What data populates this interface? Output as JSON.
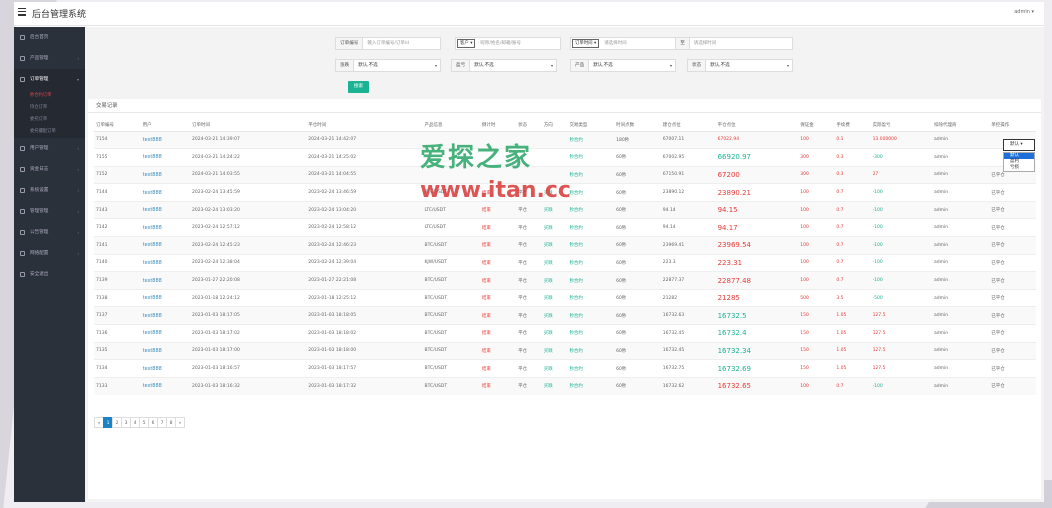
{
  "app": {
    "title": "后台管理系统",
    "user": "admin ▾"
  },
  "sidebar": [
    {
      "label": "后台首页",
      "active": false,
      "arrow": ""
    },
    {
      "label": "产品管理",
      "active": false,
      "arrow": "‹"
    },
    {
      "label": "订单管理",
      "active": true,
      "arrow": "▾"
    },
    {
      "label": "用户管理",
      "active": false,
      "arrow": "‹"
    },
    {
      "label": "资金日志",
      "active": false,
      "arrow": "‹"
    },
    {
      "label": "系统设置",
      "active": false,
      "arrow": "‹"
    },
    {
      "label": "管理管理",
      "active": false,
      "arrow": "‹"
    },
    {
      "label": "公告管理",
      "active": false,
      "arrow": "‹"
    },
    {
      "label": "网络配置",
      "active": false,
      "arrow": "‹"
    },
    {
      "label": "安全退出",
      "active": false,
      "arrow": ""
    }
  ],
  "sidebar_sub": [
    "秒合约订单",
    "持仓订单",
    "委托订单",
    "委托撮配订单"
  ],
  "filters": {
    "order_no_label": "订单编号",
    "order_no_placeholder": "输入订单编号/订单id",
    "user_select": "客户",
    "user_placeholder": "昵称/姓名/邮箱/账号",
    "time_select": "订单时间",
    "time_start_placeholder": "请选择时间",
    "time_to": "至",
    "time_end_placeholder": "请选择时间",
    "pnl_label": "涨跌",
    "pnl_value": "默认,不选",
    "account_label": "盈亏",
    "account_value": "默认,不选",
    "product_label": "产品",
    "product_value": "默认,不选",
    "status_label": "状态",
    "status_value": "默认,不选",
    "search_button": "搜索"
  },
  "box_title": "交易记录",
  "columns": [
    "订单编号",
    "用户",
    "订单时间",
    "平仓时间",
    "产品信息",
    "倒计时",
    "状态",
    "方向",
    "交易类型",
    "时间点数",
    "建仓点位",
    "平仓点位",
    "保证金",
    "手续费",
    "实际盈亏",
    "扣除代理商",
    "单控操作"
  ],
  "rows": [
    {
      "id": "7154",
      "user": "test888",
      "ot": "2024-03-21 14:39:07",
      "ct": "2024-03-21 14:42:07",
      "prod": "",
      "cd": "",
      "st": "",
      "dir": "",
      "type": "秒合约",
      "tp": "180秒",
      "open": "67007.11",
      "close": "67022.94",
      "close_c": "redval",
      "margin": "100",
      "fee": "0.1",
      "pnl": "13.000000",
      "pnl_c": "red",
      "agent": "admin",
      "op": ""
    },
    {
      "id": "7155",
      "user": "test888",
      "ot": "2024-03-21 14:24:22",
      "ct": "2024-03-21 14:25:02",
      "prod": "",
      "cd": "",
      "st": "",
      "dir": "",
      "type": "秒合约",
      "tp": "60秒",
      "open": "67002.95",
      "close": "66920.97",
      "close_c": "biggreen",
      "margin": "300",
      "fee": "0.3",
      "pnl": "-300",
      "pnl_c": "green",
      "agent": "admin",
      "op": ""
    },
    {
      "id": "7152",
      "user": "test888",
      "ot": "2024-03-21 14:03:55",
      "ct": "2024-03-21 14:04:55",
      "prod": "",
      "cd": "",
      "st": "",
      "dir": "",
      "type": "秒合约",
      "tp": "60秒",
      "open": "67150.91",
      "close": "67200",
      "close_c": "bigred",
      "margin": "300",
      "fee": "0.3",
      "pnl": "27",
      "pnl_c": "red",
      "agent": "admin",
      "op": "已平仓"
    },
    {
      "id": "7144",
      "user": "test888",
      "ot": "2023-02-24 13:45:59",
      "ct": "2023-02-24 13:46:59",
      "prod": "BTC/USDT",
      "cd": "结束",
      "st": "平仓",
      "dir": "买跌",
      "type": "秒合约",
      "tp": "60秒",
      "open": "23890.12",
      "close": "23890.21",
      "close_c": "bigred",
      "margin": "100",
      "fee": "0.7",
      "pnl": "-100",
      "pnl_c": "green",
      "agent": "admin",
      "op": "已平仓"
    },
    {
      "id": "7143",
      "user": "test888",
      "ot": "2023-02-24 13:03:20",
      "ct": "2023-02-24 13:04:20",
      "prod": "LTC/USDT",
      "cd": "结束",
      "st": "平仓",
      "dir": "买跌",
      "type": "秒合约",
      "tp": "60秒",
      "open": "94.14",
      "close": "94.15",
      "close_c": "bigred",
      "margin": "100",
      "fee": "0.7",
      "pnl": "-100",
      "pnl_c": "green",
      "agent": "admin",
      "op": "已平仓"
    },
    {
      "id": "7142",
      "user": "test888",
      "ot": "2023-02-24 12:57:12",
      "ct": "2023-02-24 12:58:12",
      "prod": "LTC/USDT",
      "cd": "结束",
      "st": "平仓",
      "dir": "买跌",
      "type": "秒合约",
      "tp": "60秒",
      "open": "94.14",
      "close": "94.17",
      "close_c": "bigred",
      "margin": "100",
      "fee": "0.7",
      "pnl": "-100",
      "pnl_c": "green",
      "agent": "admin",
      "op": "已平仓"
    },
    {
      "id": "7141",
      "user": "test888",
      "ot": "2023-02-24 12:45:23",
      "ct": "2023-02-24 12:46:23",
      "prod": "BTC/USDT",
      "cd": "结束",
      "st": "平仓",
      "dir": "买跌",
      "type": "秒合约",
      "tp": "60秒",
      "open": "23969.41",
      "close": "23969.54",
      "close_c": "bigred",
      "margin": "100",
      "fee": "0.7",
      "pnl": "-100",
      "pnl_c": "green",
      "agent": "admin",
      "op": "已平仓"
    },
    {
      "id": "7140",
      "user": "test888",
      "ot": "2023-02-24 12:38:04",
      "ct": "2023-02-24 12:39:04",
      "prod": "KJW/USDT",
      "cd": "结束",
      "st": "平仓",
      "dir": "买跌",
      "type": "秒合约",
      "tp": "60秒",
      "open": "223.3",
      "close": "223.31",
      "close_c": "bigred",
      "margin": "100",
      "fee": "0.7",
      "pnl": "-100",
      "pnl_c": "green",
      "agent": "admin",
      "op": "已平仓"
    },
    {
      "id": "7139",
      "user": "test888",
      "ot": "2023-01-27 22:20:08",
      "ct": "2023-01-27 22:21:08",
      "prod": "BTC/USDT",
      "cd": "结束",
      "st": "平仓",
      "dir": "买跌",
      "type": "秒合约",
      "tp": "60秒",
      "open": "22877.37",
      "close": "22877.48",
      "close_c": "bigred",
      "margin": "100",
      "fee": "0.7",
      "pnl": "-100",
      "pnl_c": "green",
      "agent": "admin",
      "op": "已平仓"
    },
    {
      "id": "7138",
      "user": "test888",
      "ot": "2023-01-18 12:24:12",
      "ct": "2023-01-18 12:25:12",
      "prod": "BTC/USDT",
      "cd": "结束",
      "st": "平仓",
      "dir": "买跌",
      "type": "秒合约",
      "tp": "60秒",
      "open": "21282",
      "close": "21285",
      "close_c": "bigred",
      "margin": "500",
      "fee": "3.5",
      "pnl": "-500",
      "pnl_c": "green",
      "agent": "admin",
      "op": "已平仓"
    },
    {
      "id": "7137",
      "user": "test888",
      "ot": "2023-01-03 18:17:05",
      "ct": "2023-01-03 18:18:05",
      "prod": "BTC/USDT",
      "cd": "结束",
      "st": "平仓",
      "dir": "买跌",
      "type": "秒合约",
      "tp": "60秒",
      "open": "16732.63",
      "close": "16732.5",
      "close_c": "biggreen",
      "margin": "150",
      "fee": "1.05",
      "pnl": "127.5",
      "pnl_c": "red",
      "agent": "admin",
      "op": "已平仓"
    },
    {
      "id": "7136",
      "user": "test888",
      "ot": "2023-01-03 18:17:02",
      "ct": "2023-01-03 18:18:02",
      "prod": "BTC/USDT",
      "cd": "结束",
      "st": "平仓",
      "dir": "买跌",
      "type": "秒合约",
      "tp": "60秒",
      "open": "16732.45",
      "close": "16732.4",
      "close_c": "biggreen",
      "margin": "150",
      "fee": "1.05",
      "pnl": "127.5",
      "pnl_c": "red",
      "agent": "admin",
      "op": "已平仓"
    },
    {
      "id": "7135",
      "user": "test888",
      "ot": "2023-01-03 18:17:00",
      "ct": "2023-01-03 18:18:00",
      "prod": "BTC/USDT",
      "cd": "结束",
      "st": "平仓",
      "dir": "买跌",
      "type": "秒合约",
      "tp": "60秒",
      "open": "16732.45",
      "close": "16732.34",
      "close_c": "biggreen",
      "margin": "150",
      "fee": "1.05",
      "pnl": "127.5",
      "pnl_c": "red",
      "agent": "admin",
      "op": "已平仓"
    },
    {
      "id": "7134",
      "user": "test888",
      "ot": "2023-01-03 18:16:57",
      "ct": "2023-01-03 18:17:57",
      "prod": "BTC/USDT",
      "cd": "结束",
      "st": "平仓",
      "dir": "买跌",
      "type": "秒合约",
      "tp": "60秒",
      "open": "16732.75",
      "close": "16732.69",
      "close_c": "biggreen",
      "margin": "150",
      "fee": "1.05",
      "pnl": "127.5",
      "pnl_c": "red",
      "agent": "admin",
      "op": "已平仓"
    },
    {
      "id": "7133",
      "user": "test888",
      "ot": "2023-01-03 18:16:32",
      "ct": "2023-01-03 18:17:32",
      "prod": "BTC/USDT",
      "cd": "结束",
      "st": "平仓",
      "dir": "买跌",
      "type": "秒合约",
      "tp": "60秒",
      "open": "16732.62",
      "close": "16732.65",
      "close_c": "bigred",
      "margin": "100",
      "fee": "0.7",
      "pnl": "-100",
      "pnl_c": "green",
      "agent": "admin",
      "op": "已平仓"
    }
  ],
  "dropdown": {
    "value": "默认",
    "options": [
      "默认",
      "盈利",
      "亏损"
    ],
    "selected": 0
  },
  "pager": [
    "«",
    "1",
    "2",
    "3",
    "4",
    "5",
    "6",
    "7",
    "8",
    "»"
  ],
  "pager_current": "1",
  "watermark": {
    "text": "爱探之家",
    "url": "www.itan.cc"
  }
}
